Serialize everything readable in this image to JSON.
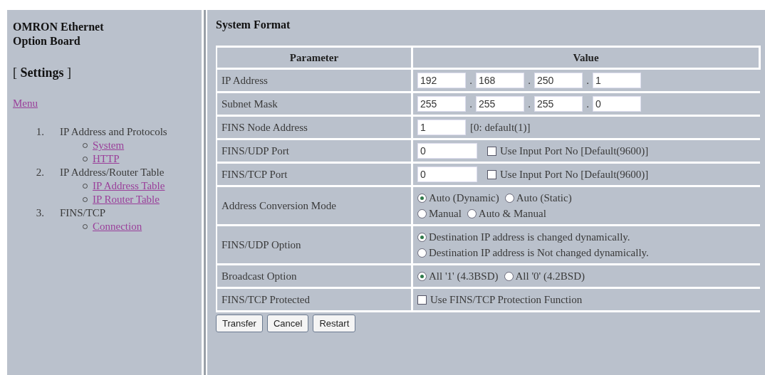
{
  "sidebar": {
    "title": "OMRON Ethernet Option Board",
    "heading": "[ **Settings** ]",
    "menu_link": "Menu",
    "items": [
      {
        "number": "1.",
        "label": "IP Address and Protocols",
        "children": [
          {
            "label": "System"
          },
          {
            "label": "HTTP"
          }
        ]
      },
      {
        "number": "2.",
        "label": "IP Address/Router Table",
        "children": [
          {
            "label": "IP Address Table"
          },
          {
            "label": "IP Router Table"
          }
        ]
      },
      {
        "number": "3.",
        "label": "FINS/TCP",
        "children": [
          {
            "label": "Connection"
          }
        ]
      }
    ]
  },
  "main": {
    "title": "System Format",
    "columns": [
      "Parameter",
      "Value"
    ],
    "rows": [
      {
        "parameter": "IP Address",
        "kind": "octets",
        "values": [
          "192",
          "168",
          "250",
          "1"
        ],
        "separator": "."
      },
      {
        "parameter": "Subnet Mask",
        "kind": "octets",
        "values": [
          "255",
          "255",
          "255",
          "0"
        ],
        "separator": "."
      },
      {
        "parameter": "FINS Node Address",
        "kind": "input_note",
        "value": "1",
        "note": "[0: default(1)]"
      },
      {
        "parameter": "FINS/UDP Port",
        "kind": "input_check",
        "value": "0",
        "checkbox": {
          "label": "Use Input Port No [Default(9600)]",
          "checked": false
        }
      },
      {
        "parameter": "FINS/TCP Port",
        "kind": "input_check",
        "value": "0",
        "checkbox": {
          "label": "Use Input Port No [Default(9600)]",
          "checked": false
        }
      },
      {
        "parameter": "Address Conversion Mode",
        "kind": "radios",
        "lines": [
          {
            "options": [
              {
                "label": "Auto (Dynamic)",
                "selected": true
              },
              {
                "label": "Auto (Static)",
                "selected": false
              }
            ]
          },
          {
            "options": [
              {
                "label": "Manual",
                "selected": false
              },
              {
                "label": "Auto & Manual",
                "selected": false
              }
            ]
          }
        ]
      },
      {
        "parameter": "FINS/UDP Option",
        "kind": "radios",
        "lines": [
          {
            "options": [
              {
                "label": "Destination IP address is changed dynamically.",
                "selected": true
              }
            ]
          },
          {
            "options": [
              {
                "label": "Destination IP address is Not changed dynamically.",
                "selected": false
              }
            ]
          }
        ]
      },
      {
        "parameter": "Broadcast Option",
        "kind": "radios",
        "lines": [
          {
            "options": [
              {
                "label": "All '1' (4.3BSD)",
                "selected": true
              },
              {
                "label": "All '0' (4.2BSD)",
                "selected": false
              }
            ]
          }
        ]
      },
      {
        "parameter": "FINS/TCP Protected",
        "kind": "check",
        "checkbox": {
          "label": "Use FINS/TCP Protection Function",
          "checked": false
        }
      }
    ],
    "buttons": [
      "Transfer",
      "Cancel",
      "Restart"
    ]
  }
}
